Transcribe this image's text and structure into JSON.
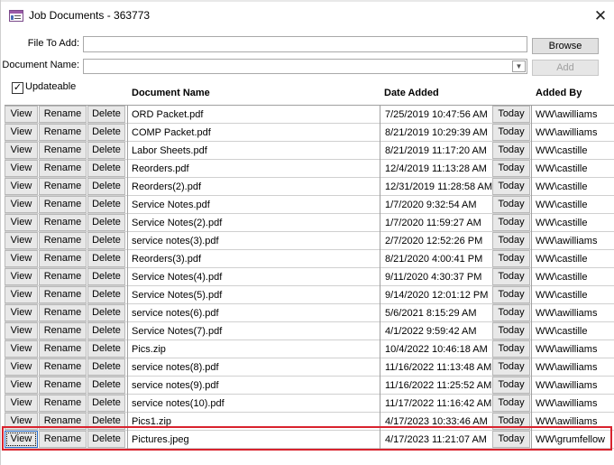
{
  "window": {
    "title": "Job Documents - 363773"
  },
  "form": {
    "file_label": "File To Add:",
    "file_value": "",
    "browse_label": "Browse",
    "doc_name_label": "Document Name:",
    "doc_name_value": "",
    "add_label": "Add",
    "updateable_label": "Updateable",
    "updateable_checked": "✓"
  },
  "columns": {
    "document_name": "Document Name",
    "date_added": "Date Added",
    "added_by": "Added By"
  },
  "row_buttons": {
    "view": "View",
    "rename": "Rename",
    "delete": "Delete",
    "today": "Today"
  },
  "rows": [
    {
      "name": "ORD Packet.pdf",
      "date": "7/25/2019 10:47:56 AM",
      "by": "WW\\awilliams"
    },
    {
      "name": "COMP Packet.pdf",
      "date": "8/21/2019 10:29:39 AM",
      "by": "WW\\awilliams"
    },
    {
      "name": "Labor Sheets.pdf",
      "date": "8/21/2019 11:17:20 AM",
      "by": "WW\\castille"
    },
    {
      "name": "Reorders.pdf",
      "date": "12/4/2019 11:13:28 AM",
      "by": "WW\\castille"
    },
    {
      "name": "Reorders(2).pdf",
      "date": "12/31/2019 11:28:58 AM",
      "by": "WW\\castille"
    },
    {
      "name": "Service Notes.pdf",
      "date": "1/7/2020 9:32:54 AM",
      "by": "WW\\castille"
    },
    {
      "name": "Service Notes(2).pdf",
      "date": "1/7/2020 11:59:27 AM",
      "by": "WW\\castille"
    },
    {
      "name": "service notes(3).pdf",
      "date": "2/7/2020 12:52:26 PM",
      "by": "WW\\awilliams"
    },
    {
      "name": "Reorders(3).pdf",
      "date": "8/21/2020 4:00:41 PM",
      "by": "WW\\castille"
    },
    {
      "name": "Service Notes(4).pdf",
      "date": "9/11/2020 4:30:37 PM",
      "by": "WW\\castille"
    },
    {
      "name": "Service Notes(5).pdf",
      "date": "9/14/2020 12:01:12 PM",
      "by": "WW\\castille"
    },
    {
      "name": "service notes(6).pdf",
      "date": "5/6/2021 8:15:29 AM",
      "by": "WW\\awilliams"
    },
    {
      "name": "Service Notes(7).pdf",
      "date": "4/1/2022 9:59:42 AM",
      "by": "WW\\castille"
    },
    {
      "name": "Pics.zip",
      "date": "10/4/2022 10:46:18 AM",
      "by": "WW\\awilliams"
    },
    {
      "name": "service notes(8).pdf",
      "date": "11/16/2022 11:13:48 AM",
      "by": "WW\\awilliams"
    },
    {
      "name": "service notes(9).pdf",
      "date": "11/16/2022 11:25:52 AM",
      "by": "WW\\awilliams"
    },
    {
      "name": "service notes(10).pdf",
      "date": "11/17/2022 11:16:42 AM",
      "by": "WW\\awilliams"
    },
    {
      "name": "Pics1.zip",
      "date": "4/17/2023 10:33:46 AM",
      "by": "WW\\awilliams"
    },
    {
      "name": "Pictures.jpeg",
      "date": "4/17/2023 11:21:07 AM",
      "by": "WW\\grumfellow"
    }
  ],
  "highlight_color": "#d9232e"
}
